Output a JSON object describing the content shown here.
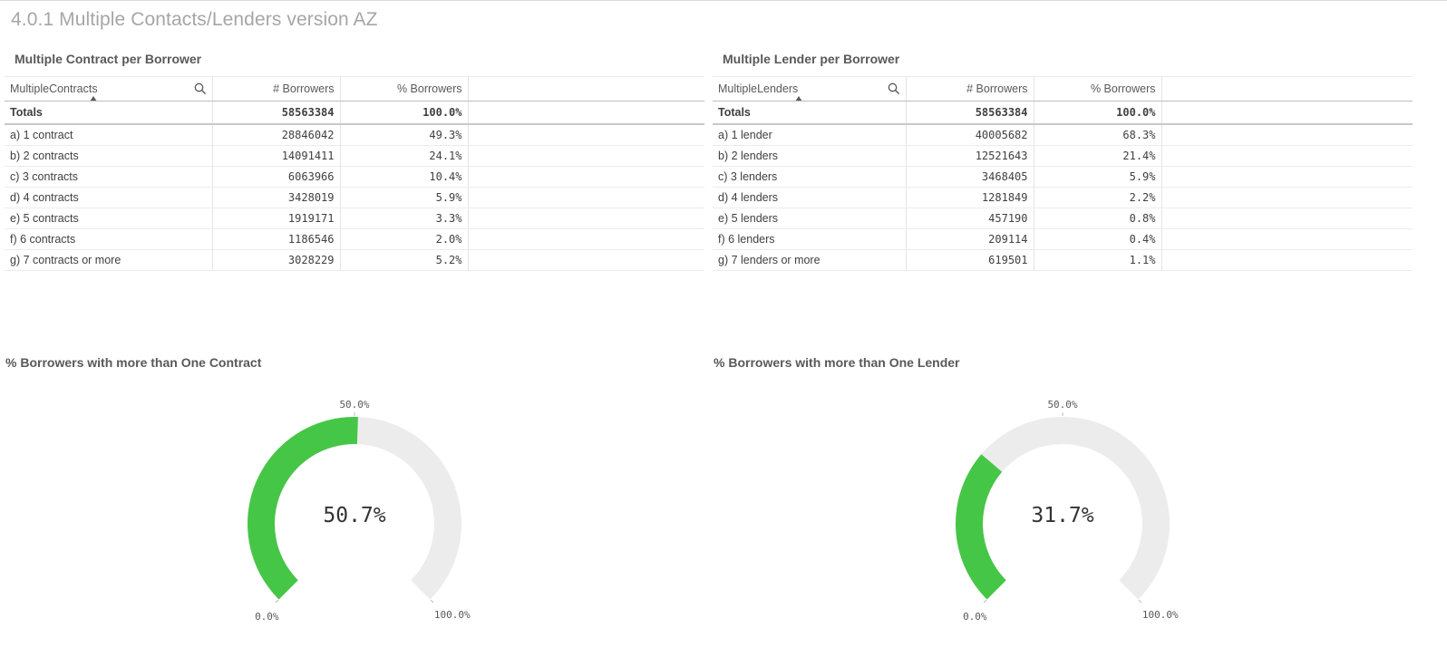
{
  "sheet": {
    "title": "4.0.1 Multiple Contacts/Lenders version AZ"
  },
  "colors": {
    "gauge_fill": "#46c646",
    "gauge_track": "#ececec",
    "table_header_border": "#bdbdbd"
  },
  "contracts_table": {
    "title": "Multiple Contract per Borrower",
    "dimension_header": "MultipleContracts",
    "measure_headers": [
      "# Borrowers",
      "% Borrowers"
    ],
    "totals": {
      "label": "Totals",
      "borrowers": "58563384",
      "pct": "100.0%"
    },
    "rows": [
      {
        "label": "a) 1 contract",
        "borrowers": "28846042",
        "pct": "49.3%"
      },
      {
        "label": "b) 2 contracts",
        "borrowers": "14091411",
        "pct": "24.1%"
      },
      {
        "label": "c) 3 contracts",
        "borrowers": "6063966",
        "pct": "10.4%"
      },
      {
        "label": "d) 4 contracts",
        "borrowers": "3428019",
        "pct": "5.9%"
      },
      {
        "label": "e) 5 contracts",
        "borrowers": "1919171",
        "pct": "3.3%"
      },
      {
        "label": "f) 6 contracts",
        "borrowers": "1186546",
        "pct": "2.0%"
      },
      {
        "label": "g) 7 contracts or more",
        "borrowers": "3028229",
        "pct": "5.2%"
      }
    ]
  },
  "lenders_table": {
    "title": "Multiple Lender per Borrower",
    "dimension_header": "MultipleLenders",
    "measure_headers": [
      "# Borrowers",
      "% Borrowers"
    ],
    "totals": {
      "label": "Totals",
      "borrowers": "58563384",
      "pct": "100.0%"
    },
    "rows": [
      {
        "label": "a) 1 lender",
        "borrowers": "40005682",
        "pct": "68.3%"
      },
      {
        "label": "b) 2 lenders",
        "borrowers": "12521643",
        "pct": "21.4%"
      },
      {
        "label": "c) 3 lenders",
        "borrowers": "3468405",
        "pct": "5.9%"
      },
      {
        "label": "d) 4 lenders",
        "borrowers": "1281849",
        "pct": "2.2%"
      },
      {
        "label": "e) 5 lenders",
        "borrowers": "457190",
        "pct": "0.8%"
      },
      {
        "label": "f) 6 lenders",
        "borrowers": "209114",
        "pct": "0.4%"
      },
      {
        "label": "g) 7 lenders or more",
        "borrowers": "619501",
        "pct": "1.1%"
      }
    ]
  },
  "gauge_contracts": {
    "title": "% Borrowers with more than One Contract",
    "value": 0.507,
    "value_label": "50.7%",
    "min_label": "0.0%",
    "mid_label": "50.0%",
    "max_label": "100.0%"
  },
  "gauge_lenders": {
    "title": "% Borrowers with more than One Lender",
    "value": 0.317,
    "value_label": "31.7%",
    "min_label": "0.0%",
    "mid_label": "50.0%",
    "max_label": "100.0%"
  }
}
